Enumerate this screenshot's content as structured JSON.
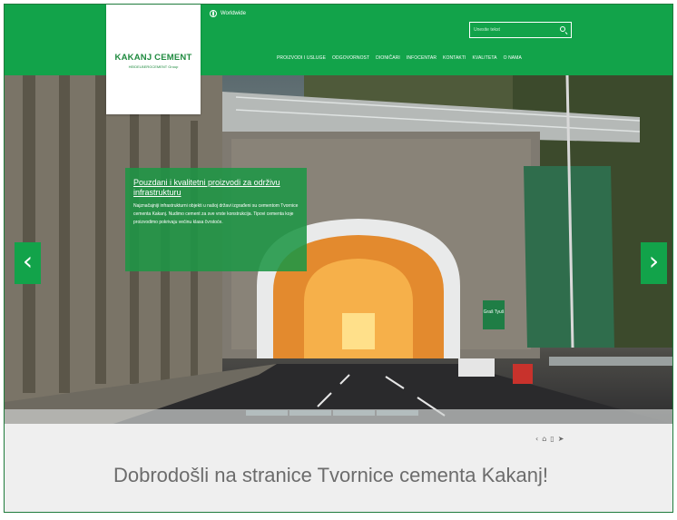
{
  "header": {
    "brand": "KAKANJ CEMENT",
    "brand_sub": "HEIDELBERGCEMENT Group",
    "worldwide": "Worldwide",
    "search_placeholder": "Unesite tekst",
    "nav": [
      "PROIZVODI I USLUGE",
      "ODGOVORNOST",
      "DIONIČARI",
      "INFOCENTAR",
      "KONTAKTI",
      "KVALITETA",
      "O NAMA"
    ]
  },
  "hero": {
    "caption_title": "Pouzdani i kvalitetni proizvodi za održivu infrastrukturu",
    "caption_text": "Najznačajniji infrastrukturni objekti u našoj državi izgrađeni su cementom Tvornice cementa Kakanj. Nudimo cement za sve vrste konstrukcija. Tipovi cementa koje proizvodimo pokrivaju većinu klasa čvrstoće.",
    "prev_label": "‹",
    "next_label": "›",
    "slides": 4,
    "sign_text": "Graš Tyuš"
  },
  "content": {
    "share_icons": [
      "share-icon",
      "print-icon",
      "delete-icon",
      "send-icon"
    ],
    "welcome": "Dobrodošli na stranice Tvornice cementa Kakanj!"
  },
  "colors": {
    "brand_green": "#12a34a",
    "caption_green": "#1e9646",
    "heading_grey": "#6c6c6c"
  }
}
